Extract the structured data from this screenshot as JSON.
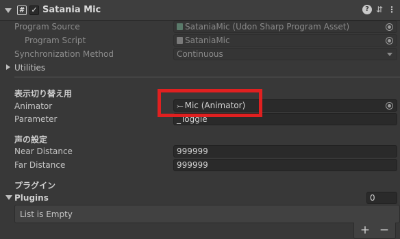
{
  "component": {
    "title": "Satania Mic",
    "enabled_mark": "✓",
    "script_icon_glyph": "#",
    "header_icons": [
      "help-icon",
      "preset-icon",
      "kebab-menu-icon"
    ]
  },
  "fields": {
    "program_source": {
      "label": "Program Source",
      "value": "SataniaMic (Udon Sharp Program Asset)"
    },
    "program_script": {
      "label": "Program Script",
      "value": "SataniaMic"
    },
    "sync_method": {
      "label": "Synchronization Method",
      "value": "Continuous"
    },
    "utilities": {
      "label": "Utilities"
    }
  },
  "section_toggle": {
    "heading": "表示切り替え用",
    "animator": {
      "label": "Animator",
      "value": "Mic (Animator)"
    },
    "parameter": {
      "label": "Parameter",
      "value": "_Toggle"
    }
  },
  "section_voice": {
    "heading": "声の設定",
    "near": {
      "label": "Near Distance",
      "value": "999999"
    },
    "far": {
      "label": "Far Distance",
      "value": "999999"
    }
  },
  "section_plugin": {
    "heading": "プラグイン",
    "plugins": {
      "label": "Plugins",
      "count": "0",
      "empty_text": "List is Empty",
      "add": "+",
      "remove": "−"
    }
  },
  "colors": {
    "highlight": "#e02020",
    "background": "#383838",
    "field": "#2a2a2a"
  }
}
